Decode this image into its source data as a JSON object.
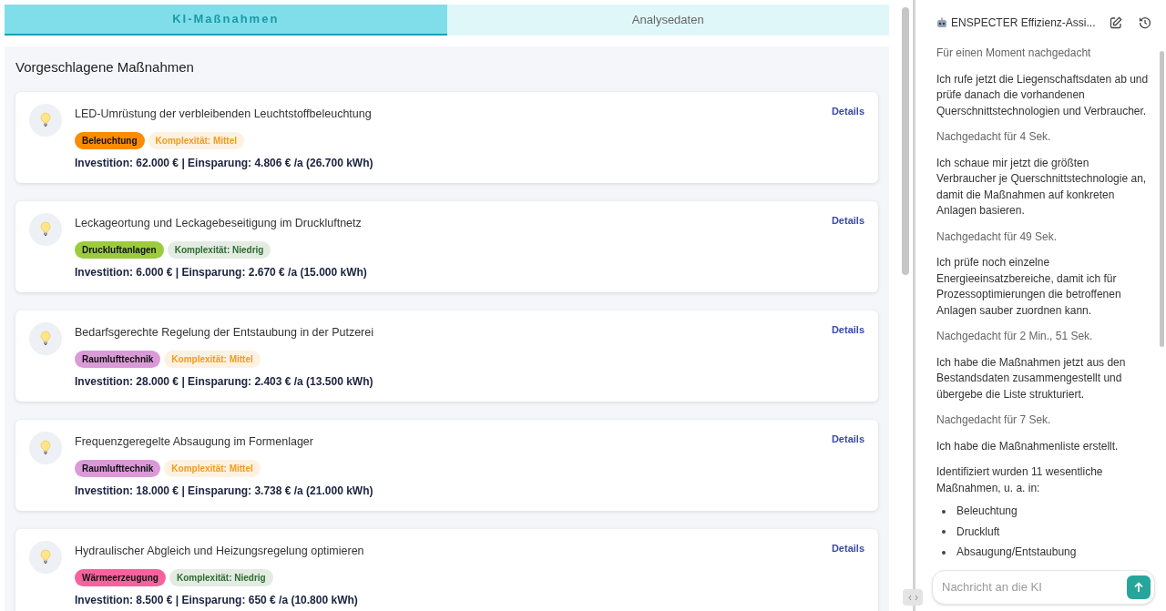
{
  "tabs": [
    {
      "label": "KI-Maßnahmen",
      "selected": true
    },
    {
      "label": "Analysedaten",
      "selected": false
    }
  ],
  "section_title": "Vorgeschlagene Maßnahmen",
  "measures": [
    {
      "title": "LED-Umrüstung der verbleibenden Leuchtstoffbeleuchtung",
      "category": "Beleuchtung",
      "color": "#fb8c00",
      "complexity": {
        "label": "Komplexität: Mittel",
        "color": "#f29a1d"
      },
      "figures": "Investition: 62.000 € | Einsparung: 4.806 € /a (26.700 kWh)",
      "link": "Details"
    },
    {
      "title": "Leckageortung und Leckagebeseitigung im Druckluftnetz",
      "category": "Druckluftanlagen",
      "color": "#9ccc3c",
      "complexity": {
        "label": "Komplexität: Niedrig",
        "color": "#2e6b30"
      },
      "figures": "Investition: 6.000 € | Einsparung: 2.670 € /a (15.000 kWh)",
      "link": "Details"
    },
    {
      "title": "Bedarfsgerechte Regelung der Entstaubung in der Putzerei",
      "category": "Raumlufttechnik",
      "color": "#da9ad8",
      "complexity": {
        "label": "Komplexität: Mittel",
        "color": "#f29a1d"
      },
      "figures": "Investition: 28.000 € | Einsparung: 2.403 € /a (13.500 kWh)",
      "link": "Details"
    },
    {
      "title": "Frequenzgeregelte Absaugung im Formenlager",
      "category": "Raumlufttechnik",
      "color": "#da9ad8",
      "complexity": {
        "label": "Komplexität: Mittel",
        "color": "#f29a1d"
      },
      "figures": "Investition: 18.000 € | Einsparung: 3.738 € /a (21.000 kWh)",
      "link": "Details"
    },
    {
      "title": "Hydraulischer Abgleich und Heizungsregelung optimieren",
      "category": "Wärmeerzeugung",
      "color": "#f7629e",
      "complexity": {
        "label": "Komplexität: Niedrig",
        "color": "#2e6b30"
      },
      "figures": "Investition: 8.500 € | Einsparung: 650 € /a (10.800 kWh)",
      "link": "Details"
    }
  ],
  "assistant": {
    "title": "ENSPECTER Effizienz-Assi...",
    "messages": [
      {
        "kind": "thought",
        "text": "Für einen Moment nachgedacht"
      },
      {
        "kind": "text",
        "text": "Ich rufe jetzt die Liegenschaftsdaten ab und prüfe danach die vorhandenen Querschnittstechnologien und Verbraucher."
      },
      {
        "kind": "thought",
        "text": "Nachgedacht für 4 Sek."
      },
      {
        "kind": "text",
        "text": "Ich schaue mir jetzt die größten Verbraucher je Querschnittstechnologie an, damit die Maßnahmen auf konkreten Anlagen basieren."
      },
      {
        "kind": "thought",
        "text": "Nachgedacht für 49 Sek."
      },
      {
        "kind": "text",
        "text": "Ich prüfe noch einzelne Energieeinsatzbereiche, damit ich für Prozessoptimierungen die betroffenen Anlagen sauber zuordnen kann."
      },
      {
        "kind": "thought",
        "text": "Nachgedacht für 2 Min., 51 Sek."
      },
      {
        "kind": "text",
        "text": "Ich habe die Maßnahmen jetzt aus den Bestandsdaten zusammengestellt und übergebe die Liste strukturiert."
      },
      {
        "kind": "thought",
        "text": "Nachgedacht für 7 Sek."
      },
      {
        "kind": "text",
        "text": "Ich habe die Maßnahmenliste erstellt."
      },
      {
        "kind": "text",
        "text": "Identifiziert wurden 11 wesentliche Maßnahmen, u. a. in:"
      },
      {
        "kind": "list",
        "items": [
          "Beleuchtung",
          "Druckluft",
          "Absaugung/Entstaubung"
        ]
      }
    ],
    "input": {
      "placeholder": "Nachricht an die KI"
    }
  }
}
